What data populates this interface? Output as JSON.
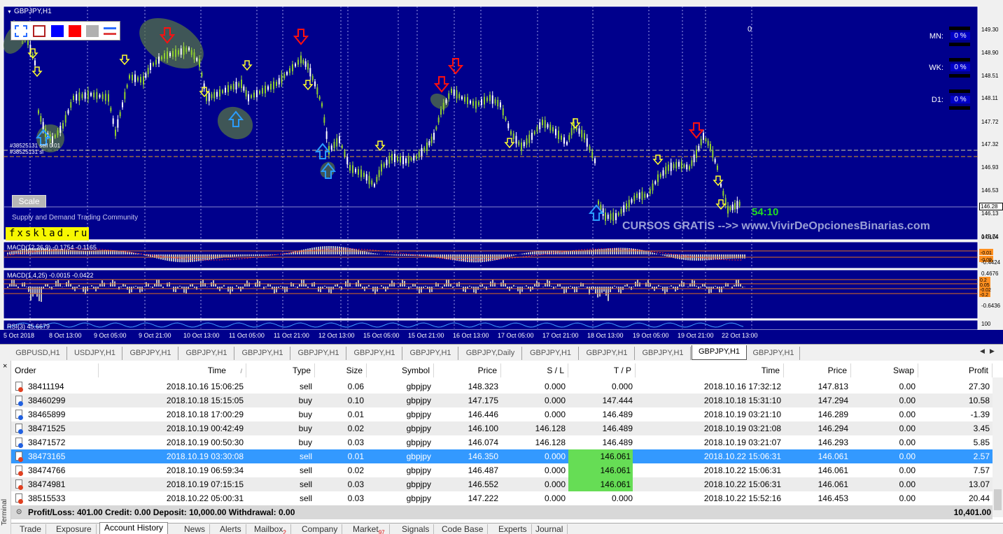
{
  "chart_window": {
    "title": "GBPJPY,H1",
    "scale_button": "Scale",
    "community_text": "Supply and Demand Trading Community",
    "brand": "fxsklad.ru",
    "promo": "CURSOS GRATIS -->> www.VivirDeOpcionesBinarias.com",
    "countdown": "54:10",
    "zero_value": "0",
    "order_label_1": "#38525131 sell 0.01",
    "order_label_2": "#38525131 sl",
    "timeframes": [
      {
        "label": "MN:",
        "value": "0 %"
      },
      {
        "label": "WK:",
        "value": "0 %"
      },
      {
        "label": "D1:",
        "value": "0 %"
      }
    ],
    "swatch_colors": [
      "#ffffff",
      "#ffffff",
      "#0000ff",
      "#ff0000",
      "#b0b0b0",
      "#2a6cff"
    ],
    "background_color": "#00008c"
  },
  "indicators": {
    "macd1_label": "MACD(12,26,9) -0.1754 -0.1165",
    "macd2_label": "MACD(1,4,25) -0.0015 -0.0422",
    "rsi_label": "RSI(3) 45.6679",
    "macd1_axis": [
      "0.0104",
      "-0.4424"
    ],
    "macd1_tags": [
      "-0.01",
      "-0.09"
    ],
    "macd2_axis": [
      "0.4676",
      "-0.6436"
    ],
    "macd2_tags": [
      "0.2",
      "0.05",
      "-0.02",
      "-0.2"
    ],
    "rsi_axis": "100"
  },
  "price_axis": {
    "labels": [
      "149.30",
      "148.90",
      "148.51",
      "148.11",
      "147.72",
      "147.32",
      "146.93",
      "146.53",
      "146.13",
      "145.74"
    ],
    "current_price": "146.28"
  },
  "time_axis": [
    "5 Oct 2018",
    "8 Oct 13:00",
    "9 Oct 05:00",
    "9 Oct 21:00",
    "10 Oct 13:00",
    "11 Oct 05:00",
    "11 Oct 21:00",
    "12 Oct 13:00",
    "15 Oct 05:00",
    "15 Oct 21:00",
    "16 Oct 13:00",
    "17 Oct 05:00",
    "17 Oct 21:00",
    "18 Oct 13:00",
    "19 Oct 05:00",
    "19 Oct 21:00",
    "22 Oct 13:00"
  ],
  "chart_tabs": [
    "GBPUSD,H1",
    "USDJPY,H1",
    "GBPJPY,H1",
    "GBPJPY,H1",
    "GBPJPY,H1",
    "GBPJPY,H1",
    "GBPJPY,H1",
    "GBPJPY,H1",
    "GBPJPY,Daily",
    "GBPJPY,H1",
    "GBPJPY,H1",
    "GBPJPY,H1",
    "GBPJPY,H1",
    "GBPJPY,H1"
  ],
  "active_chart_tab": 12,
  "terminal": {
    "side_label": "Terminal",
    "close_symbol": "×",
    "headers": [
      "Order",
      "Time",
      "Type",
      "Size",
      "Symbol",
      "Price",
      "S / L",
      "T / P",
      "Time",
      "Price",
      "Swap",
      "Profit"
    ],
    "sort_indicator": "/",
    "rows": [
      {
        "order": "38411194",
        "open_time": "2018.10.16 15:06:25",
        "type": "sell",
        "size": "0.06",
        "symbol": "gbpjpy",
        "price": "148.323",
        "sl": "0.000",
        "tp": "0.000",
        "close_time": "2018.10.16 17:32:12",
        "close_price": "147.813",
        "swap": "0.00",
        "profit": "27.30",
        "tp_hit": false
      },
      {
        "order": "38460299",
        "open_time": "2018.10.18 15:15:05",
        "type": "buy",
        "size": "0.10",
        "symbol": "gbpjpy",
        "price": "147.175",
        "sl": "0.000",
        "tp": "147.444",
        "close_time": "2018.10.18 15:31:10",
        "close_price": "147.294",
        "swap": "0.00",
        "profit": "10.58",
        "tp_hit": false
      },
      {
        "order": "38465899",
        "open_time": "2018.10.18 17:00:29",
        "type": "buy",
        "size": "0.01",
        "symbol": "gbpjpy",
        "price": "146.446",
        "sl": "0.000",
        "tp": "146.489",
        "close_time": "2018.10.19 03:21:10",
        "close_price": "146.289",
        "swap": "0.00",
        "profit": "-1.39",
        "tp_hit": false
      },
      {
        "order": "38471525",
        "open_time": "2018.10.19 00:42:49",
        "type": "buy",
        "size": "0.02",
        "symbol": "gbpjpy",
        "price": "146.100",
        "sl": "146.128",
        "tp": "146.489",
        "close_time": "2018.10.19 03:21:08",
        "close_price": "146.294",
        "swap": "0.00",
        "profit": "3.45",
        "tp_hit": false
      },
      {
        "order": "38471572",
        "open_time": "2018.10.19 00:50:30",
        "type": "buy",
        "size": "0.03",
        "symbol": "gbpjpy",
        "price": "146.074",
        "sl": "146.128",
        "tp": "146.489",
        "close_time": "2018.10.19 03:21:07",
        "close_price": "146.293",
        "swap": "0.00",
        "profit": "5.85",
        "tp_hit": false
      },
      {
        "order": "38473165",
        "open_time": "2018.10.19 03:30:08",
        "type": "sell",
        "size": "0.01",
        "symbol": "gbpjpy",
        "price": "146.350",
        "sl": "0.000",
        "tp": "146.061",
        "close_time": "2018.10.22 15:06:31",
        "close_price": "146.061",
        "swap": "0.00",
        "profit": "2.57",
        "tp_hit": true
      },
      {
        "order": "38474766",
        "open_time": "2018.10.19 06:59:34",
        "type": "sell",
        "size": "0.02",
        "symbol": "gbpjpy",
        "price": "146.487",
        "sl": "0.000",
        "tp": "146.061",
        "close_time": "2018.10.22 15:06:31",
        "close_price": "146.061",
        "swap": "0.00",
        "profit": "7.57",
        "tp_hit": true
      },
      {
        "order": "38474981",
        "open_time": "2018.10.19 07:15:15",
        "type": "sell",
        "size": "0.03",
        "symbol": "gbpjpy",
        "price": "146.552",
        "sl": "0.000",
        "tp": "146.061",
        "close_time": "2018.10.22 15:06:31",
        "close_price": "146.061",
        "swap": "0.00",
        "profit": "13.07",
        "tp_hit": true
      },
      {
        "order": "38515533",
        "open_time": "2018.10.22 05:00:31",
        "type": "sell",
        "size": "0.03",
        "symbol": "gbpjpy",
        "price": "147.222",
        "sl": "0.000",
        "tp": "0.000",
        "close_time": "2018.10.22 15:52:16",
        "close_price": "146.453",
        "swap": "0.00",
        "profit": "20.44",
        "tp_hit": false
      }
    ],
    "selected_row": 5,
    "summary_text": "Profit/Loss: 401.00  Credit: 0.00  Deposit: 10,000.00  Withdrawal: 0.00",
    "summary_total": "10,401.00",
    "bottom_tabs": [
      {
        "label": "Trade",
        "badge": ""
      },
      {
        "label": "Exposure",
        "badge": ""
      },
      {
        "label": "Account History",
        "badge": ""
      },
      {
        "label": "News",
        "badge": ""
      },
      {
        "label": "Alerts",
        "badge": ""
      },
      {
        "label": "Mailbox",
        "badge": "2"
      },
      {
        "label": "Company",
        "badge": ""
      },
      {
        "label": "Market",
        "badge": "97"
      },
      {
        "label": "Signals",
        "badge": ""
      },
      {
        "label": "Code Base",
        "badge": ""
      },
      {
        "label": "Experts",
        "badge": ""
      },
      {
        "label": "Journal",
        "badge": ""
      }
    ],
    "active_bottom_tab": 2
  }
}
